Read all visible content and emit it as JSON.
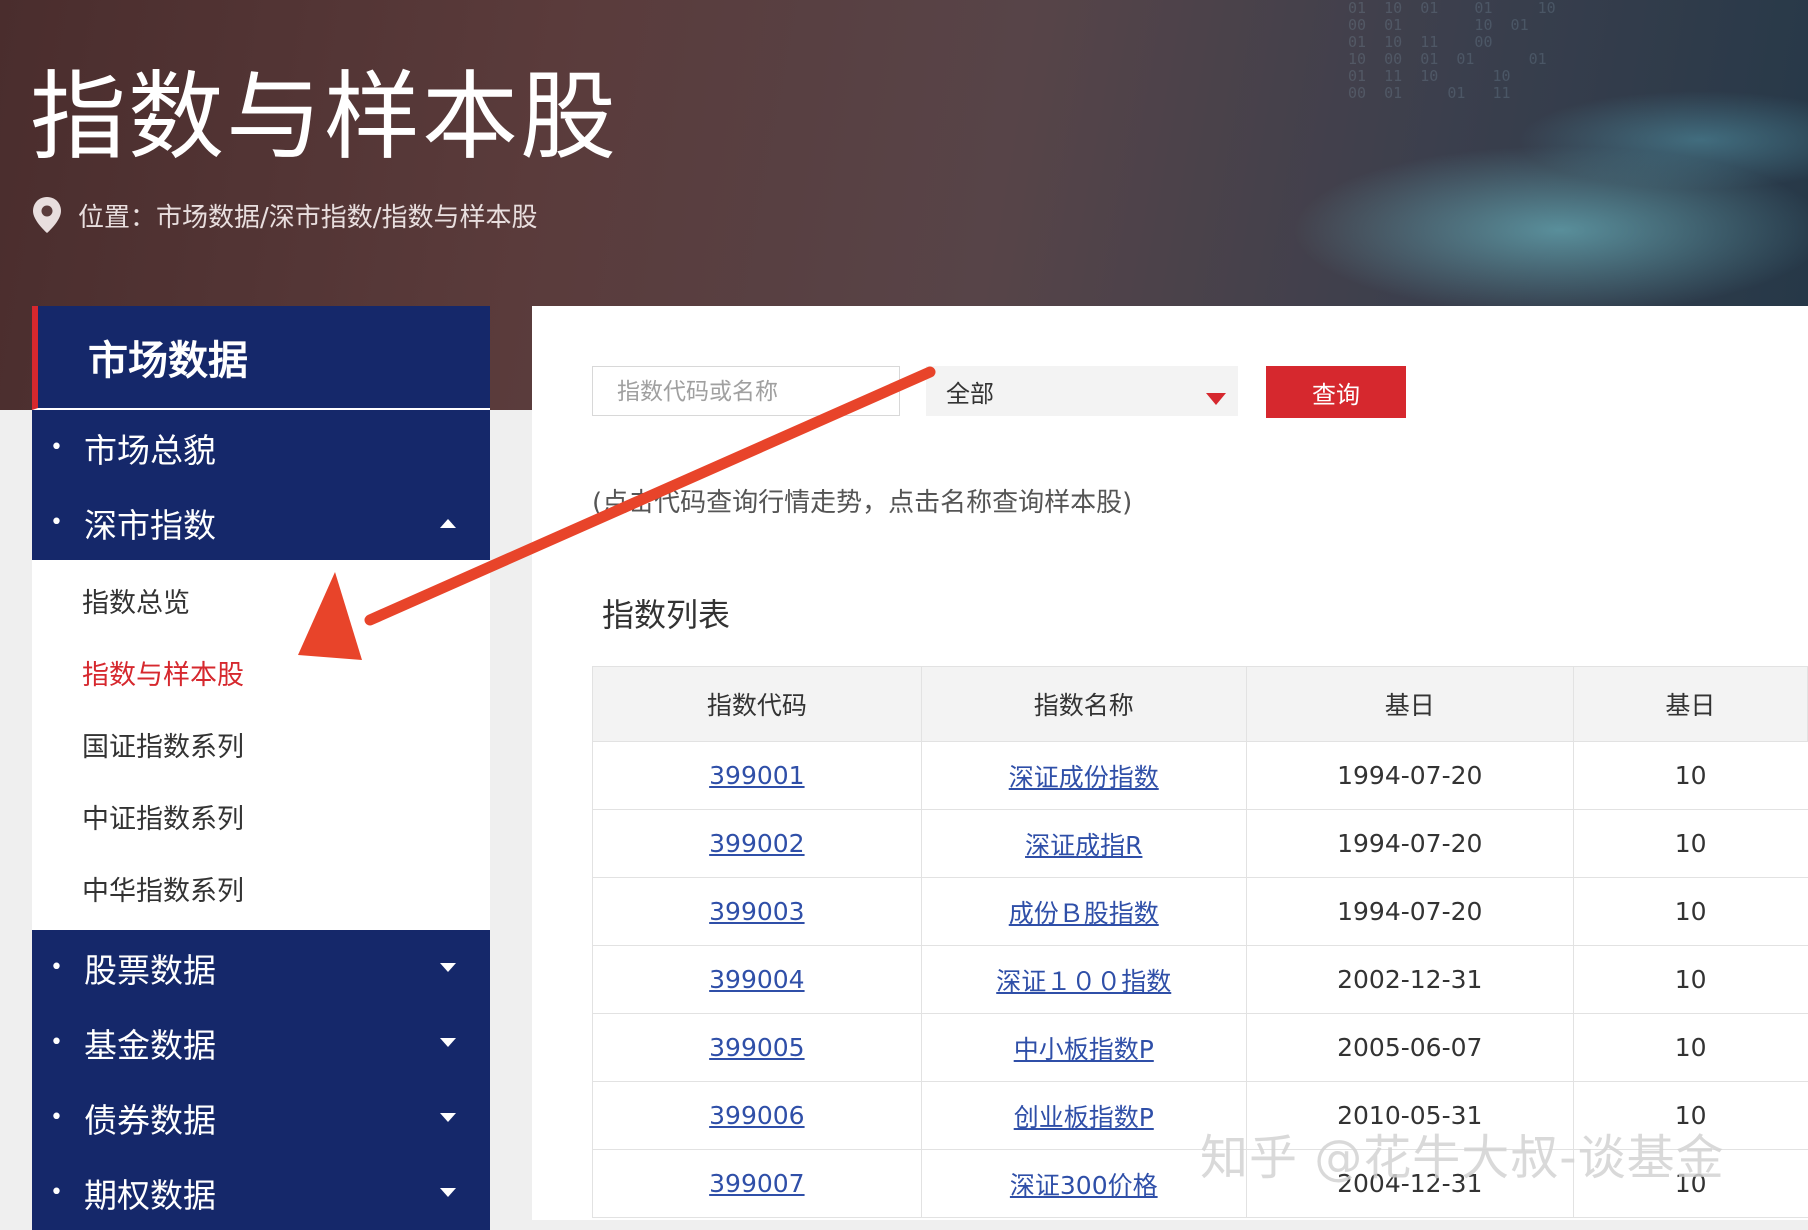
{
  "header": {
    "title": "指数与样本股",
    "breadcrumb": "位置：市场数据/深市指数/指数与样本股"
  },
  "sidebar": {
    "title": "市场数据",
    "items": [
      {
        "label": "市场总貌"
      },
      {
        "label": "深市指数",
        "expanded": true
      }
    ],
    "sub_items": [
      {
        "label": "指数总览"
      },
      {
        "label": "指数与样本股",
        "active": true
      },
      {
        "label": "国证指数系列"
      },
      {
        "label": "中证指数系列"
      },
      {
        "label": "中华指数系列"
      }
    ],
    "more_items": [
      {
        "label": "股票数据"
      },
      {
        "label": "基金数据"
      },
      {
        "label": "债券数据"
      },
      {
        "label": "期权数据"
      }
    ]
  },
  "search": {
    "placeholder": "指数代码或名称",
    "select_value": "全部",
    "button_label": "查询",
    "hint": "(点击代码查询行情走势，点击名称查询样本股)"
  },
  "list": {
    "title": "指数列表",
    "columns": [
      "指数代码",
      "指数名称",
      "基日",
      "基日"
    ],
    "rows": [
      {
        "code": "399001",
        "name": "深证成份指数",
        "base_date": "1994-07-20",
        "col4": "10"
      },
      {
        "code": "399002",
        "name": "深证成指R",
        "base_date": "1994-07-20",
        "col4": "10"
      },
      {
        "code": "399003",
        "name": "成份Ｂ股指数",
        "base_date": "1994-07-20",
        "col4": "10"
      },
      {
        "code": "399004",
        "name": "深证１００指数",
        "base_date": "2002-12-31",
        "col4": "10"
      },
      {
        "code": "399005",
        "name": "中小板指数P",
        "base_date": "2005-06-07",
        "col4": "10"
      },
      {
        "code": "399006",
        "name": "创业板指数P",
        "base_date": "2010-05-31",
        "col4": "10"
      },
      {
        "code": "399007",
        "name": "深证300价格",
        "base_date": "2004-12-31",
        "col4": "10"
      }
    ]
  },
  "watermark": "知乎 @花牛大叔-谈基金",
  "colors": {
    "navy": "#15286a",
    "accent_red": "#d6282e",
    "link_blue": "#2f4fa8",
    "arrow": "#e8442a"
  }
}
